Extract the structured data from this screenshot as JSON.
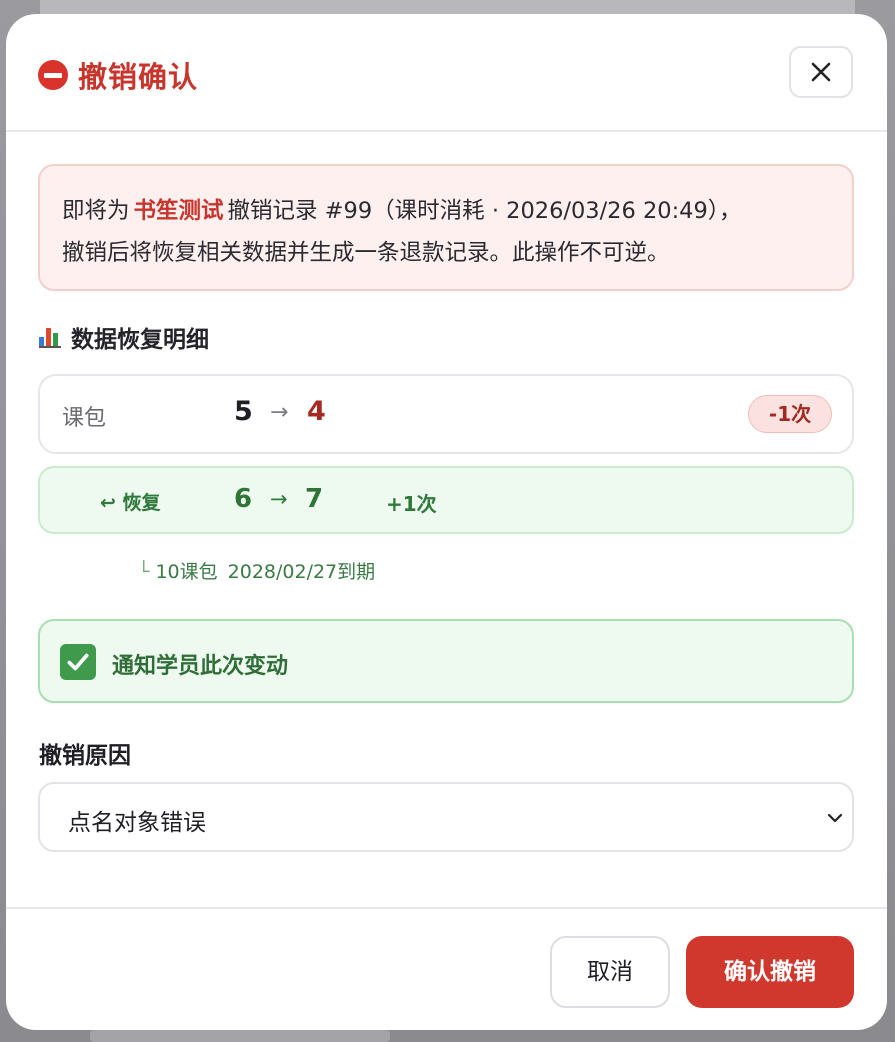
{
  "dialog": {
    "title": "撤销确认",
    "close_label": "×"
  },
  "warning": {
    "prefix": "即将为",
    "student_name": "书笙测试",
    "record_text": "撤销记录 #99（课时消耗 · 2026/03/26 20:49），",
    "line2": "撤销后将恢复相关数据并生成一条退款记录。此操作不可逆。"
  },
  "details": {
    "title": "数据恢复明细",
    "package_row": {
      "label": "课包",
      "from": "5",
      "arrow": "→",
      "to": "4",
      "badge": "-1次"
    },
    "restore_row": {
      "label": "↩ 恢复",
      "from": "6",
      "arrow": "→",
      "to": "7",
      "delta": "+1次"
    },
    "sub_note": {
      "corner": "└",
      "package": "10课包",
      "expiry": "2028/02/27到期"
    }
  },
  "notify": {
    "checked": true,
    "label": "通知学员此次变动"
  },
  "reason": {
    "title": "撤销原因",
    "selected": "点名对象错误"
  },
  "footer": {
    "cancel_label": "取消",
    "confirm_label": "确认撤销"
  },
  "colors": {
    "danger": "#c8352c",
    "success": "#2f7a3a"
  }
}
